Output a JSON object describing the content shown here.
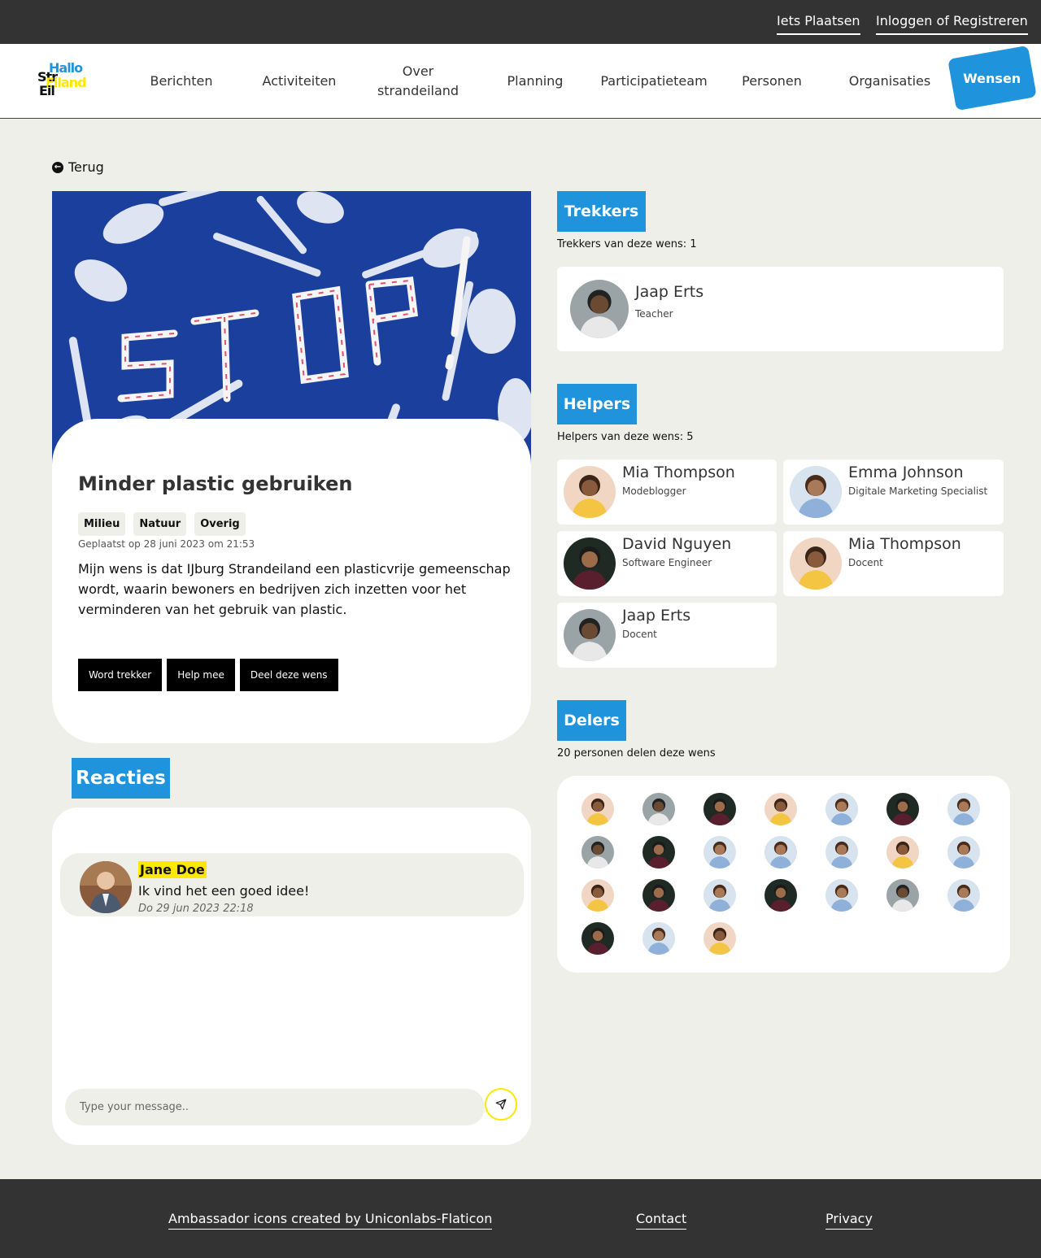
{
  "topbar": {
    "post_label": "Iets Plaatsen",
    "login_label": "Inloggen of Registreren"
  },
  "logo": {
    "line1": "Hallo",
    "line2": "Str",
    "line3": "Eiland",
    "line4": "Eil"
  },
  "nav": {
    "items": [
      "Berichten",
      "Activiteiten",
      "Over strandeiland",
      "Planning",
      "Participatieteam",
      "Personen",
      "Organisaties"
    ],
    "active": "Wensen"
  },
  "back": {
    "label": "Terug",
    "icon": "arrow-left-circle-icon"
  },
  "wish": {
    "title": "Minder plastic gebruiken",
    "tags": [
      "Milieu",
      "Natuur",
      "Overig"
    ],
    "posted": "Geplaatst op 28 juni 2023 om 21:53",
    "description": "Mijn wens is dat IJburg Strandeiland een plasticvrije gemeenschap wordt, waarin bewoners en bedrijven zich inzetten voor het verminderen van het gebruik van plastic.",
    "buttons": [
      "Word trekker",
      "Help mee",
      "Deel deze wens"
    ],
    "image_text": "STOP!"
  },
  "reacties": {
    "title": "Reacties",
    "comments": [
      {
        "name": "Jane Doe",
        "text": "Ik vind het een goed idee!",
        "date": "Do 29 jun 2023 22:18"
      }
    ],
    "input_placeholder": "Type your message..",
    "send_icon": "send-icon"
  },
  "trekkers": {
    "title": "Trekkers",
    "subtitle": "Trekkers van deze wens: 1",
    "people": [
      {
        "name": "Jaap Erts",
        "role": "Teacher"
      }
    ]
  },
  "helpers": {
    "title": "Helpers",
    "subtitle": "Helpers van deze wens: 5",
    "people": [
      {
        "name": "Mia Thompson",
        "role": "Modeblogger"
      },
      {
        "name": "Emma Johnson",
        "role": "Digitale Marketing Specialist"
      },
      {
        "name": "David Nguyen",
        "role": "Software Engineer"
      },
      {
        "name": "Mia Thompson",
        "role": "Docent"
      },
      {
        "name": "Jaap Erts",
        "role": "Docent"
      }
    ]
  },
  "delers": {
    "title": "Delers",
    "subtitle": "20 personen delen deze wens",
    "avatars": [
      "mia",
      "jaap",
      "david",
      "mia",
      "emma",
      "david",
      "emma",
      "jaap",
      "david",
      "emma",
      "emma",
      "emma",
      "mia",
      "emma",
      "mia",
      "david",
      "emma",
      "david",
      "emma",
      "jaap",
      "emma",
      "david",
      "emma",
      "mia"
    ]
  },
  "footer": {
    "credit": "Ambassador icons created by Uniconlabs-Flaticon",
    "contact": "Contact",
    "privacy": "Privacy"
  },
  "colors": {
    "accent": "#1f93dc",
    "highlight": "#ffe800",
    "dark": "#333333",
    "background": "#efefea"
  }
}
